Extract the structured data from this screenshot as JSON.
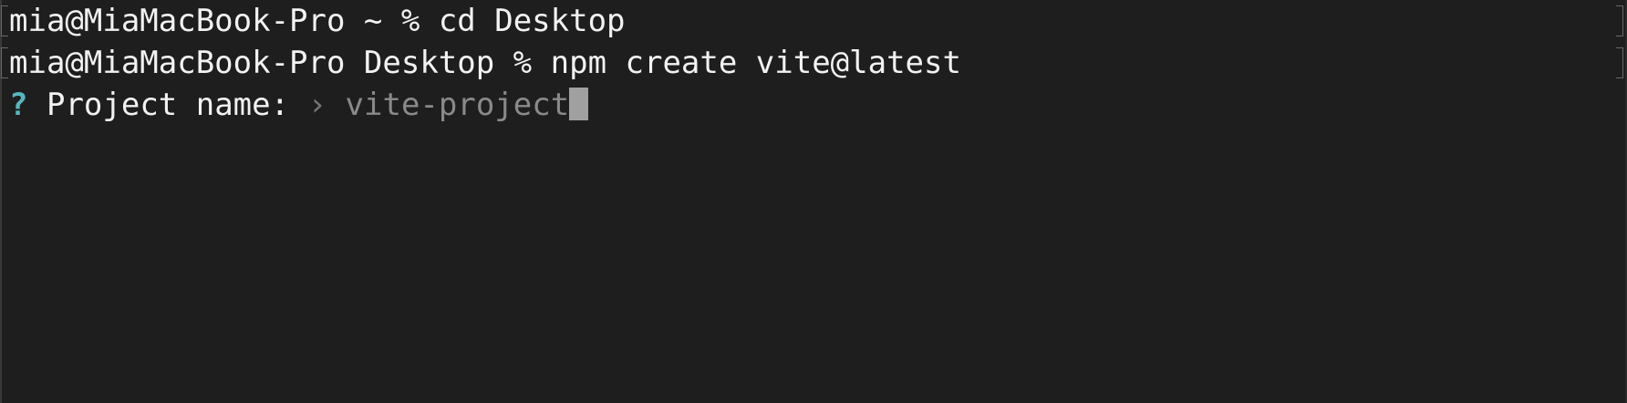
{
  "terminal": {
    "lines": [
      {
        "prompt": "mia@MiaMacBook-Pro ~ % ",
        "command": "cd Desktop"
      },
      {
        "prompt": "mia@MiaMacBook-Pro Desktop % ",
        "command": "npm create vite@latest"
      }
    ],
    "question": {
      "mark": "?",
      "label": "Project name:",
      "arrow": "›",
      "placeholder": "vite-project"
    }
  },
  "colors": {
    "background": "#1e1e1e",
    "text": "#f2f2f2",
    "question_mark": "#56b6c2",
    "placeholder": "#8a8a8a",
    "cursor": "#a0a0a0"
  }
}
